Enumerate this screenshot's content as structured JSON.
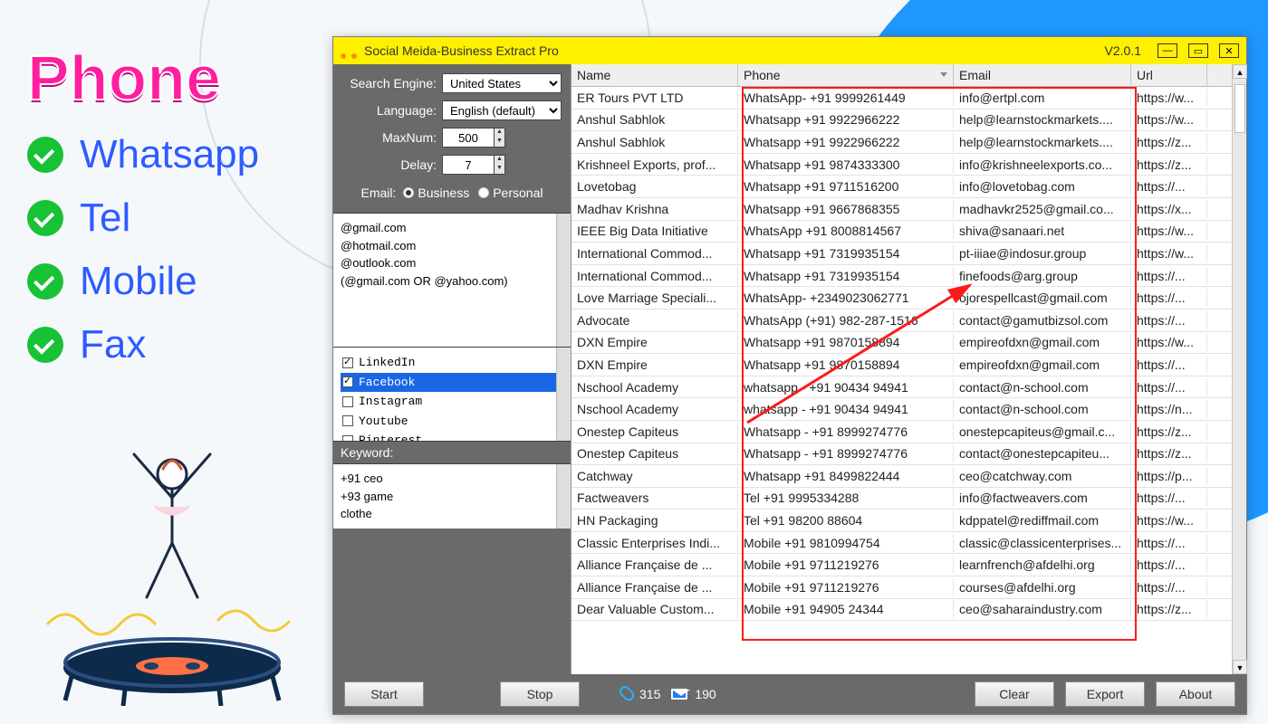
{
  "promo": {
    "headline": "Phone",
    "items": [
      "Whatsapp",
      "Tel",
      "Mobile",
      "Fax"
    ]
  },
  "app": {
    "title": "Social Meida-Business Extract Pro",
    "version": "V2.0.1"
  },
  "sidebar": {
    "search_engine_label": "Search Engine:",
    "search_engine_value": "United States",
    "language_label": "Language:",
    "language_value": "English (default)",
    "maxnum_label": "MaxNum:",
    "maxnum_value": "500",
    "delay_label": "Delay:",
    "delay_value": "7",
    "email_label": "Email:",
    "email_business": "Business",
    "email_personal": "Personal",
    "email_selected": "business",
    "domains_text": "@gmail.com\n@hotmail.com\n@outlook.com\n(@gmail.com OR @yahoo.com)",
    "platforms": [
      {
        "label": "LinkedIn",
        "checked": true,
        "selected": false
      },
      {
        "label": "Facebook",
        "checked": true,
        "selected": true
      },
      {
        "label": "Instagram",
        "checked": false,
        "selected": false
      },
      {
        "label": "Youtube",
        "checked": false,
        "selected": false
      },
      {
        "label": "Pinterest",
        "checked": false,
        "selected": false
      }
    ],
    "keyword_label": "Keyword:",
    "keywords_text": "+91 ceo\n+93 game\nclothe"
  },
  "table": {
    "headers": {
      "name": "Name",
      "phone": "Phone",
      "email": "Email",
      "url": "Url"
    },
    "rows": [
      {
        "name": "ER Tours PVT LTD",
        "phone": "WhatsApp- +91 9999261449",
        "email": "info@ertpl.com",
        "url": "https://w..."
      },
      {
        "name": "Anshul Sabhlok",
        "phone": "Whatsapp +91 9922966222",
        "email": "help@learnstockmarkets....",
        "url": "https://w..."
      },
      {
        "name": "Anshul Sabhlok",
        "phone": "Whatsapp +91 9922966222",
        "email": "help@learnstockmarkets....",
        "url": "https://z..."
      },
      {
        "name": "Krishneel Exports, prof...",
        "phone": "Whatsapp +91 9874333300",
        "email": "info@krishneelexports.co...",
        "url": "https://z..."
      },
      {
        "name": "Lovetobag",
        "phone": "Whatsapp +91 9711516200",
        "email": "info@lovetobag.com",
        "url": "https://..."
      },
      {
        "name": "Madhav Krishna",
        "phone": "Whatsapp +91 9667868355",
        "email": "madhavkr2525@gmail.co...",
        "url": "https://x..."
      },
      {
        "name": "IEEE Big Data Initiative",
        "phone": "WhatsApp +91 8008814567",
        "email": "shiva@sanaari.net",
        "url": "https://w..."
      },
      {
        "name": "International Commod...",
        "phone": "Whatsapp +91 7319935154",
        "email": "pt-iiiae@indosur.group",
        "url": "https://w..."
      },
      {
        "name": "International Commod...",
        "phone": "Whatsapp +91 7319935154",
        "email": "finefoods@arg.group",
        "url": "https://..."
      },
      {
        "name": "Love Marriage Speciali...",
        "phone": "WhatsApp- +2349023062771",
        "email": "ojorespellcast@gmail.com",
        "url": "https://..."
      },
      {
        "name": "Advocate",
        "phone": "WhatsApp (+91) 982-287-1516",
        "email": "contact@gamutbizsol.com",
        "url": "https://..."
      },
      {
        "name": "DXN Empire",
        "phone": "Whatsapp  +91 9870158894",
        "email": "empireofdxn@gmail.com",
        "url": "https://w..."
      },
      {
        "name": "DXN Empire",
        "phone": "Whatsapp  +91 9870158894",
        "email": "empireofdxn@gmail.com",
        "url": "https://..."
      },
      {
        "name": "Nschool Academy",
        "phone": "whatsapp - +91 90434 94941",
        "email": "contact@n-school.com",
        "url": "https://..."
      },
      {
        "name": "Nschool Academy",
        "phone": "whatsapp - +91 90434 94941",
        "email": "contact@n-school.com",
        "url": "https://n..."
      },
      {
        "name": "Onestep Capiteus",
        "phone": "Whatsapp - +91 8999274776",
        "email": "onestepcapiteus@gmail.c...",
        "url": "https://z..."
      },
      {
        "name": "Onestep Capiteus",
        "phone": "Whatsapp - +91 8999274776",
        "email": "contact@onestepcapiteu...",
        "url": "https://z..."
      },
      {
        "name": "Catchway",
        "phone": "Whatsapp  +91 8499822444",
        "email": "ceo@catchway.com",
        "url": "https://p..."
      },
      {
        "name": "Factweavers",
        "phone": "Tel +91 9995334288",
        "email": "info@factweavers.com",
        "url": "https://..."
      },
      {
        "name": "HN Packaging",
        "phone": "Tel +91 98200 88604",
        "email": "kdppatel@rediffmail.com",
        "url": "https://w..."
      },
      {
        "name": "Classic Enterprises Indi...",
        "phone": "Mobile +91 9810994754",
        "email": "classic@classicenterprises...",
        "url": "https://..."
      },
      {
        "name": "Alliance Française de ...",
        "phone": "Mobile +91 9711219276",
        "email": "learnfrench@afdelhi.org",
        "url": "https://..."
      },
      {
        "name": "Alliance Française de ...",
        "phone": "Mobile +91 9711219276",
        "email": "courses@afdelhi.org",
        "url": "https://..."
      },
      {
        "name": "Dear Valuable Custom...",
        "phone": "Mobile +91 94905 24344",
        "email": "ceo@saharaindustry.com",
        "url": "https://z..."
      }
    ]
  },
  "bottombar": {
    "start": "Start",
    "stop": "Stop",
    "links_count": "315",
    "emails_count": "190",
    "clear": "Clear",
    "export": "Export",
    "about": "About"
  }
}
